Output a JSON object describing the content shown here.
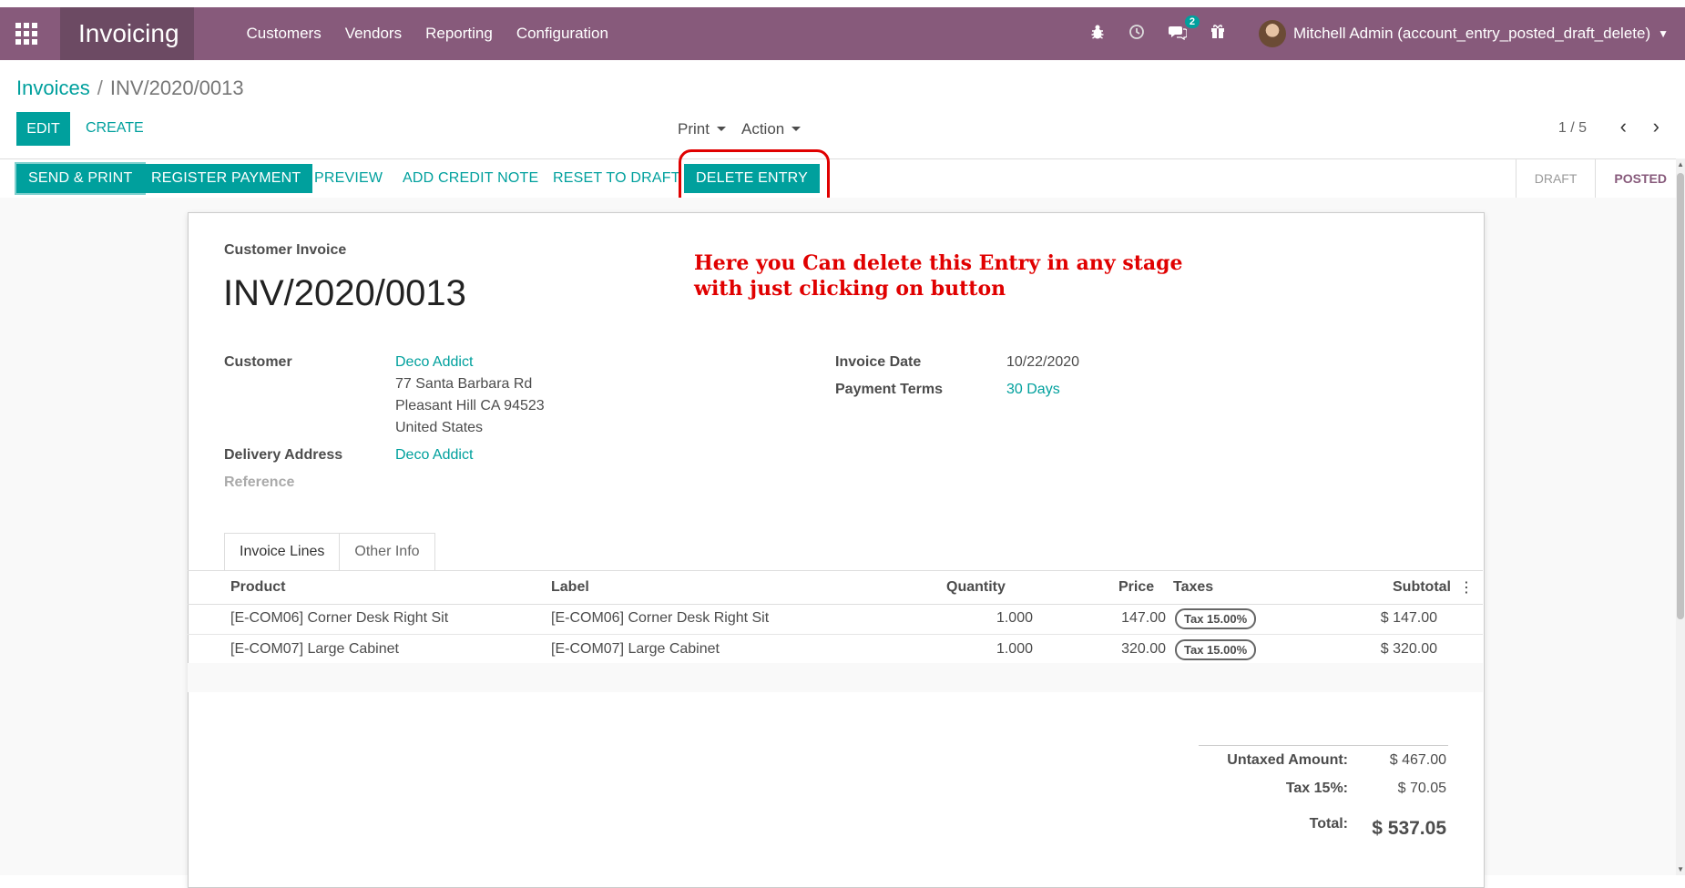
{
  "topbar": {
    "app_name": "Invoicing",
    "menu": [
      "Customers",
      "Vendors",
      "Reporting",
      "Configuration"
    ],
    "icons": [
      "bug-icon",
      "clock-icon",
      "chat-icon",
      "gift-icon"
    ],
    "messages_badge": "2",
    "user": "Mitchell Admin (account_entry_posted_draft_delete)"
  },
  "breadcrumb": {
    "parent": "Invoices",
    "separator": "/",
    "current": "INV/2020/0013"
  },
  "controls": {
    "edit": "EDIT",
    "create": "CREATE",
    "print": "Print",
    "action": "Action",
    "pager": "1 / 5"
  },
  "statusbar": {
    "buttons": [
      "SEND & PRINT",
      "REGISTER PAYMENT",
      "PREVIEW",
      "ADD CREDIT NOTE",
      "RESET TO DRAFT",
      "DELETE ENTRY"
    ],
    "stages": [
      "DRAFT",
      "POSTED"
    ],
    "active_stage": "POSTED"
  },
  "annotation": {
    "line1": "Here you Can delete this Entry in any stage",
    "line2": "with just clicking on button"
  },
  "form": {
    "doc_type": "Customer Invoice",
    "number": "INV/2020/0013",
    "customer_label": "Customer",
    "customer_name": "Deco Addict",
    "address_1": "77 Santa Barbara Rd",
    "address_2": "Pleasant Hill CA 94523",
    "address_3": "United States",
    "delivery_label": "Delivery Address",
    "delivery_value": "Deco Addict",
    "reference_label": "Reference",
    "invoice_date_label": "Invoice Date",
    "invoice_date": "10/22/2020",
    "payment_terms_label": "Payment Terms",
    "payment_terms": "30 Days"
  },
  "tabs": [
    "Invoice Lines",
    "Other Info"
  ],
  "lines": {
    "headers": [
      "Product",
      "Label",
      "Quantity",
      "Price",
      "Taxes",
      "Subtotal"
    ],
    "rows": [
      {
        "product": "[E-COM06] Corner Desk Right Sit",
        "label": "[E-COM06] Corner Desk Right Sit",
        "quantity": "1.000",
        "price": "147.00",
        "tax": "Tax 15.00%",
        "subtotal": "$ 147.00"
      },
      {
        "product": "[E-COM07] Large Cabinet",
        "label": "[E-COM07] Large Cabinet",
        "quantity": "1.000",
        "price": "320.00",
        "tax": "Tax 15.00%",
        "subtotal": "$ 320.00"
      }
    ]
  },
  "totals": {
    "untaxed_label": "Untaxed Amount:",
    "untaxed": "$ 467.00",
    "tax_label": "Tax 15%:",
    "tax": "$ 70.05",
    "total_label": "Total:",
    "total": "$ 537.05"
  },
  "colors": {
    "brand": "#875a7b",
    "accent": "#00a09d",
    "annotation": "#e00000"
  }
}
